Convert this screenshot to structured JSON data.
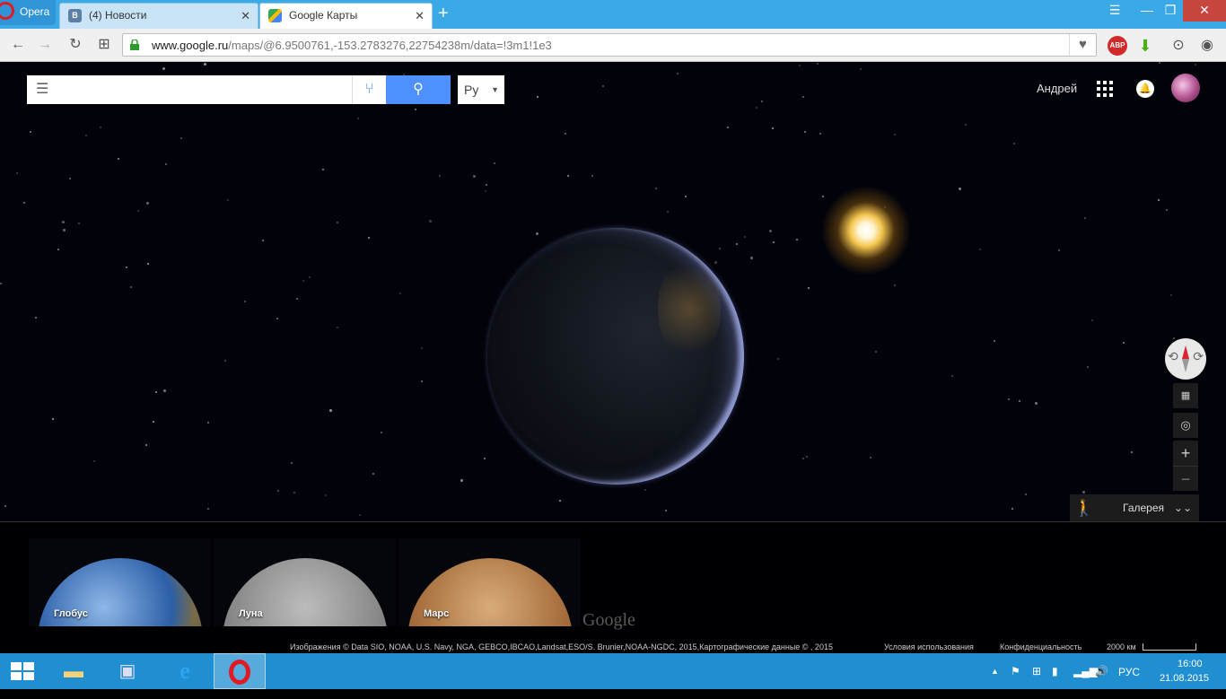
{
  "browser": {
    "menu_label": "Opera",
    "tabs": [
      {
        "label": "(4) Новости",
        "active": false,
        "icon": "vk-icon",
        "icon_color": "#5b7fa6"
      },
      {
        "label": "Google Карты",
        "active": true,
        "icon": "google-maps-icon",
        "icon_color": "#34a853"
      }
    ],
    "new_tab": "+",
    "url_host": "www.google.ru",
    "url_path": "/maps/@6.9500761,-153.2783276,22754238m/data=!3m1!1e3",
    "abp_label": "ABP",
    "colors": {
      "tabstrip": "#3aa9e6",
      "close": "#c7463e"
    }
  },
  "maps": {
    "search": {
      "value": "",
      "placeholder": ""
    },
    "language": "Ру",
    "user_name": "Андрей",
    "gallery_label": "Галерея",
    "planets": [
      {
        "label": "Глобус"
      },
      {
        "label": "Луна"
      },
      {
        "label": "Марс"
      }
    ],
    "watermark": "Google",
    "attribution": "Изображения © Data SIO, NOAA, U.S. Navy, NGA, GEBCO,IBCAO,Landsat,ESO/S. Brunier,NOAA-NGDC, 2015,Картографические данные © , 2015",
    "terms": "Условия использования",
    "privacy": "Конфиденциальность",
    "scale": "2000 км",
    "accent_color": "#4d90fe"
  },
  "taskbar": {
    "lang": "РУС",
    "time": "16:00",
    "date": "21.08.2015"
  }
}
